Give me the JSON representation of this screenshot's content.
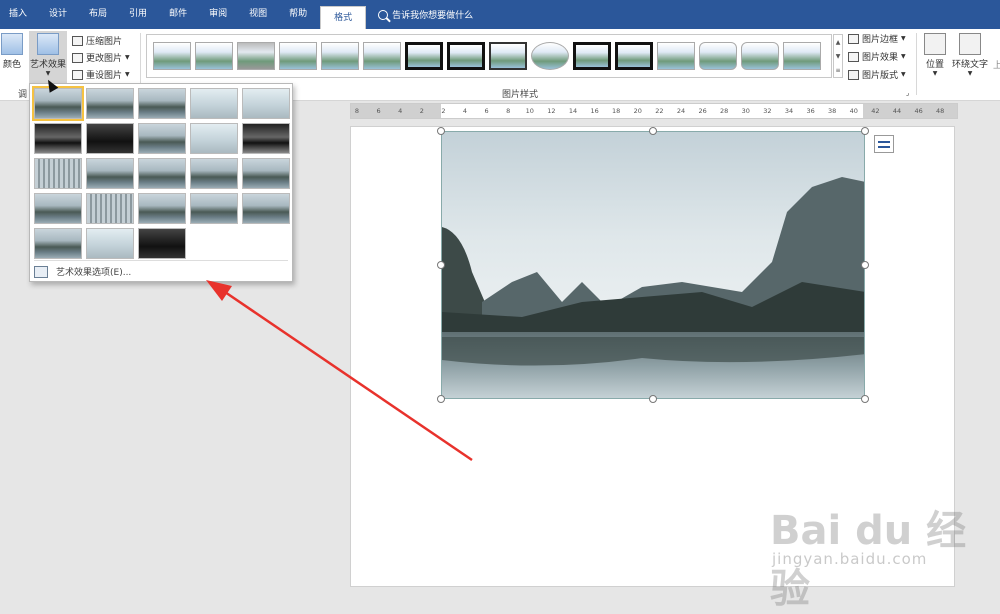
{
  "tabs": [
    {
      "label": "插入"
    },
    {
      "label": "设计"
    },
    {
      "label": "布局"
    },
    {
      "label": "引用"
    },
    {
      "label": "邮件"
    },
    {
      "label": "审阅"
    },
    {
      "label": "视图"
    },
    {
      "label": "帮助"
    },
    {
      "label": "格式",
      "active": true
    }
  ],
  "tell_me": "告诉我你想要做什么",
  "ribbon": {
    "color_label": "颜色",
    "art_effects_label": "艺术效果",
    "compress_label": "压缩图片",
    "change_label": "更改图片",
    "reset_label": "重设图片",
    "adjust_group_label": "调",
    "styles_group_label": "图片样式",
    "border_label": "图片边框",
    "effects_label": "图片效果",
    "layout_label": "图片版式",
    "position_label": "位置",
    "wrap_label": "环绕文字",
    "wrap_extra": "上"
  },
  "art_dropdown": {
    "option_label": "艺术效果选项(E)..."
  },
  "ruler_ticks": [
    "8",
    "6",
    "4",
    "2",
    "2",
    "4",
    "6",
    "8",
    "10",
    "12",
    "14",
    "16",
    "18",
    "20",
    "22",
    "24",
    "26",
    "28",
    "30",
    "32",
    "34",
    "36",
    "38",
    "40",
    "42",
    "44",
    "46",
    "48"
  ],
  "watermark": {
    "brand": "Bai du 经验",
    "url": "jingyan.baidu.com"
  },
  "colors": {
    "ribbon_blue": "#2b579a",
    "arrow_red": "#e8322c",
    "selection_gold": "#f5c242"
  }
}
